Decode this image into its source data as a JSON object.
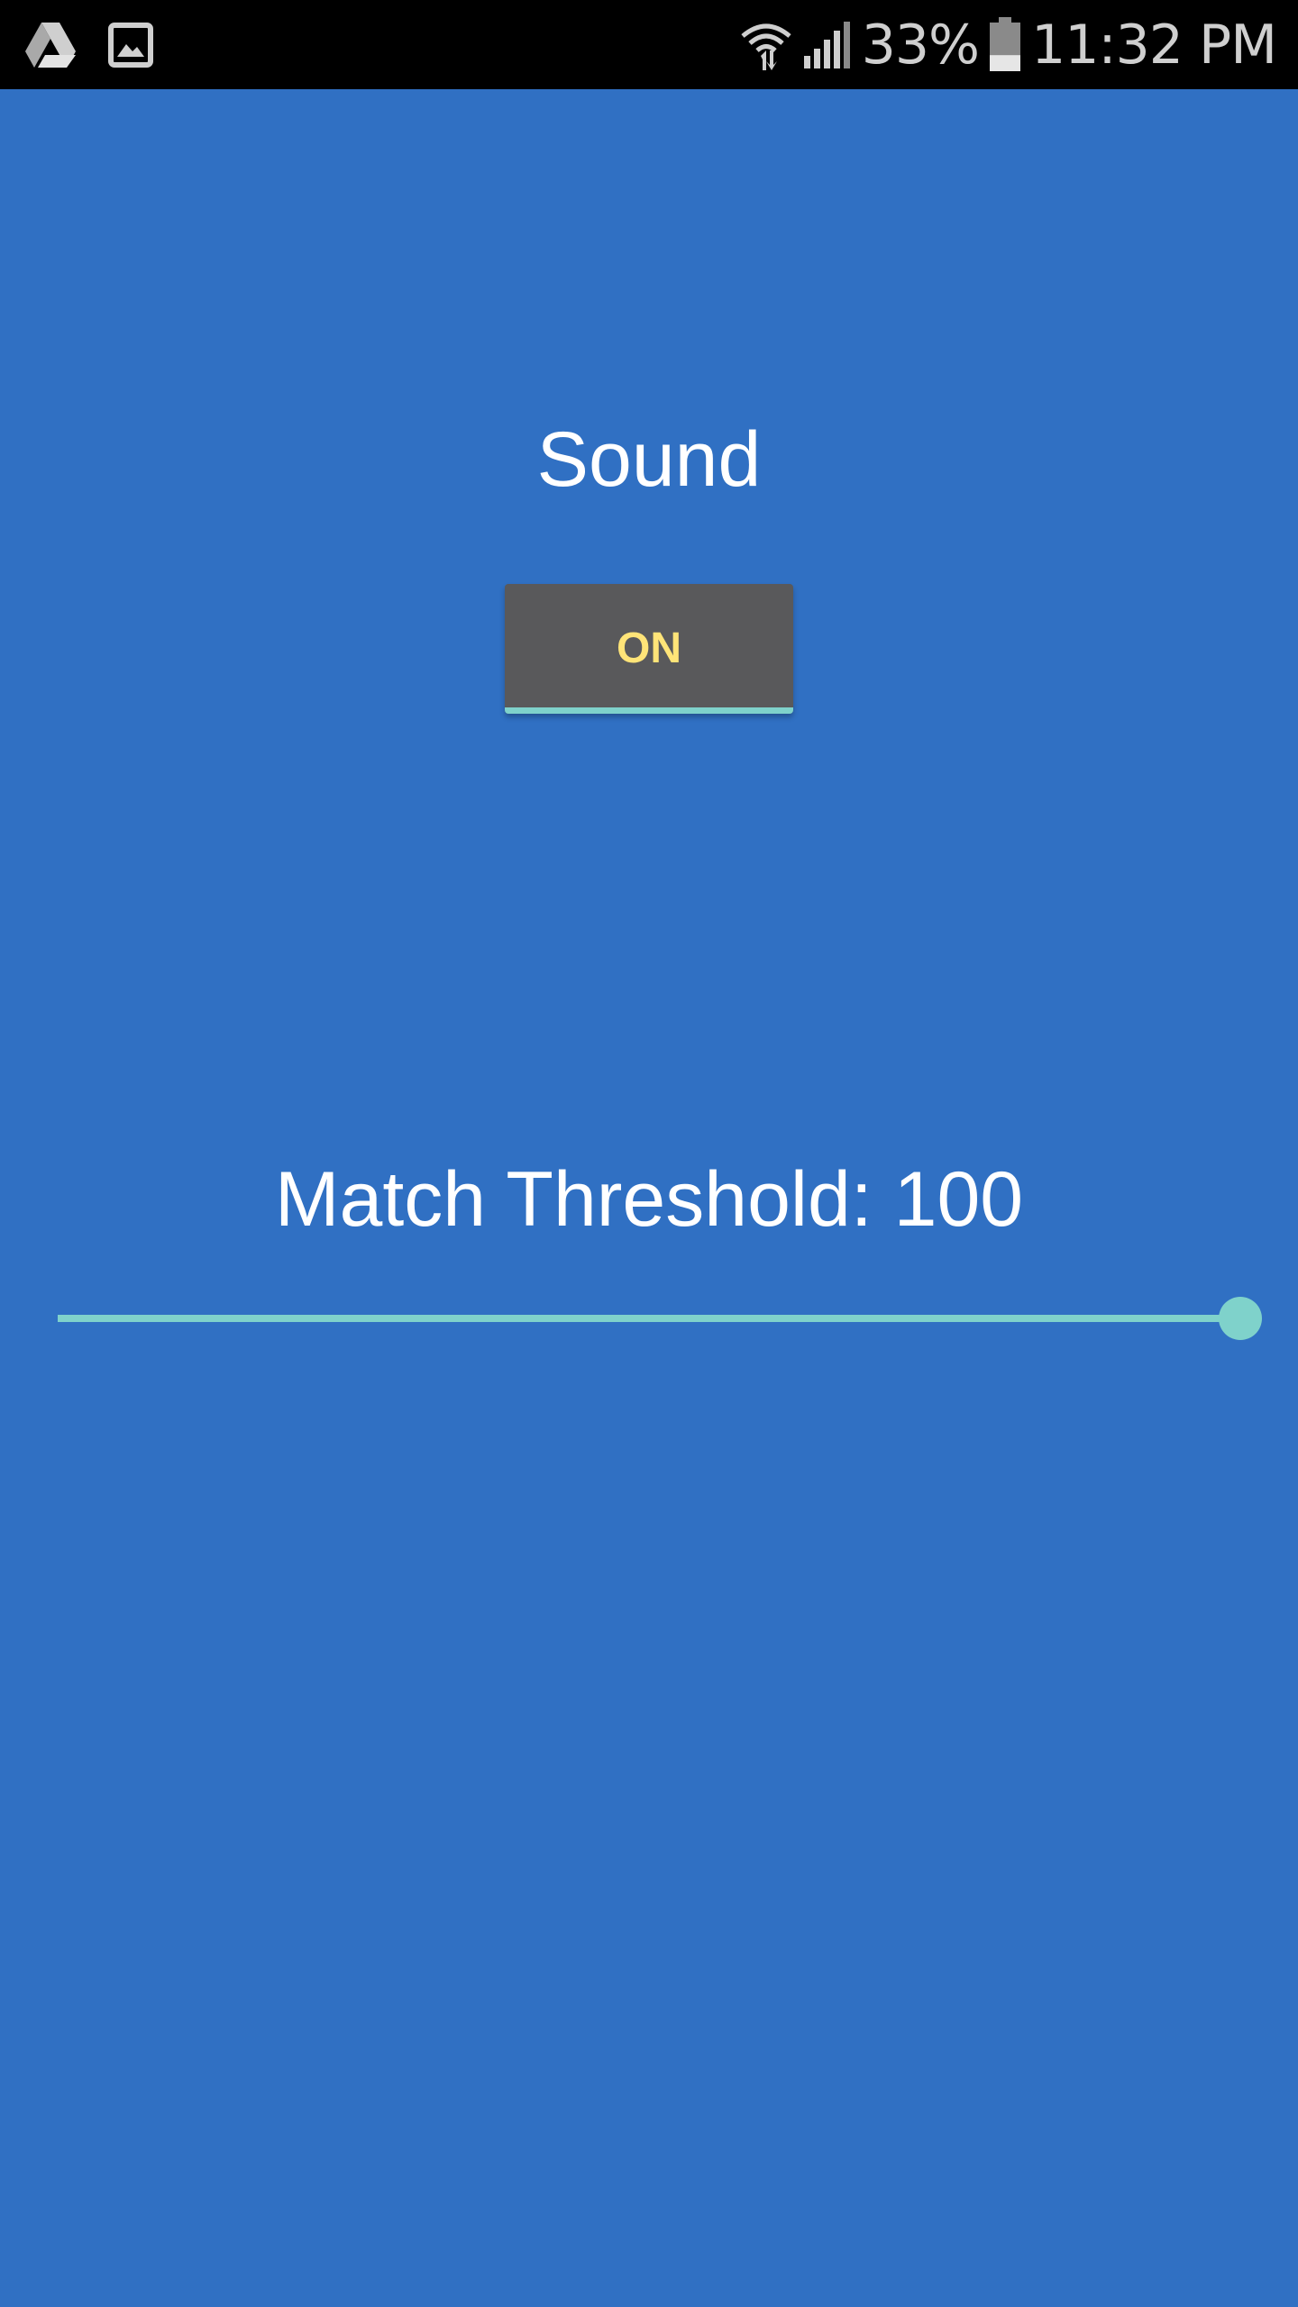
{
  "status_bar": {
    "left_icons": [
      "google-drive-icon",
      "gallery-icon"
    ],
    "right_icons": [
      "wifi-icon",
      "signal-icon",
      "battery-icon"
    ],
    "battery_percent": "33%",
    "battery_level": 0.33,
    "time": "11:32 PM"
  },
  "sound": {
    "title": "Sound",
    "toggle_label": "ON",
    "toggle_on": true
  },
  "threshold": {
    "label": "Match Threshold: 100",
    "value": 100,
    "min": 0,
    "max": 100
  },
  "colors": {
    "background": "#3070c3",
    "status_bar": "#000000",
    "button_bg": "#59595b",
    "button_text": "#ffe478",
    "accent": "#7fd2cb",
    "text": "#ffffff"
  }
}
